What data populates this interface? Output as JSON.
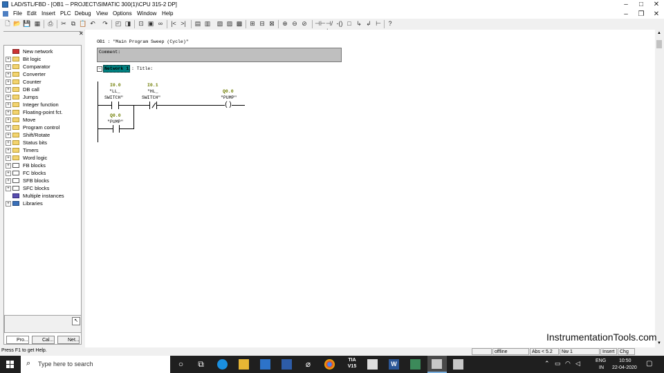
{
  "window": {
    "title": "LAD/STL/FBD  - [OB1 -- PROJECT\\SIMATIC 300(1)\\CPU 315-2 DP]"
  },
  "menu": [
    "File",
    "Edit",
    "Insert",
    "PLC",
    "Debug",
    "View",
    "Options",
    "Window",
    "Help"
  ],
  "tree": {
    "items": [
      {
        "label": "New network",
        "expand": ""
      },
      {
        "label": "Bit logic",
        "expand": "+"
      },
      {
        "label": "Comparator",
        "expand": "+"
      },
      {
        "label": "Converter",
        "expand": "+"
      },
      {
        "label": "Counter",
        "expand": "+"
      },
      {
        "label": "DB call",
        "expand": "+"
      },
      {
        "label": "Jumps",
        "expand": "+"
      },
      {
        "label": "Integer function",
        "expand": "+"
      },
      {
        "label": "Floating-point fct.",
        "expand": "+"
      },
      {
        "label": "Move",
        "expand": "+"
      },
      {
        "label": "Program control",
        "expand": "+"
      },
      {
        "label": "Shift/Rotate",
        "expand": "+"
      },
      {
        "label": "Status bits",
        "expand": "+"
      },
      {
        "label": "Timers",
        "expand": "+"
      },
      {
        "label": "Word logic",
        "expand": "+"
      },
      {
        "label": "FB blocks",
        "expand": "+"
      },
      {
        "label": "FC blocks",
        "expand": "+"
      },
      {
        "label": "SFB blocks",
        "expand": "+"
      },
      {
        "label": "SFC blocks",
        "expand": "+"
      },
      {
        "label": "Multiple instances",
        "expand": ""
      },
      {
        "label": "Libraries",
        "expand": "+"
      }
    ]
  },
  "tabs": [
    "Pro...",
    "Cal...",
    "Net..."
  ],
  "editor": {
    "block_title": "OB1 :   \"Main Program Sweep (Cycle)\"",
    "comment_label": "Comment:",
    "network_label": "Network 1",
    "network_title": ": Title:",
    "contacts": [
      {
        "addr": "I0.0",
        "sym1": "\"LL_",
        "sym2": "SWITCH\""
      },
      {
        "addr": "I0.1",
        "sym1": "\"HL_",
        "sym2": "SWITCH\""
      },
      {
        "addr": "Q0.0",
        "sym1": "\"PUMP\"",
        "sym2": ""
      }
    ],
    "coil": {
      "addr": "Q0.0",
      "sym": "\"PUMP\""
    }
  },
  "status": {
    "help": "Press F1 to get Help.",
    "mode": "offline",
    "abs": "Abs < 5.2",
    "nw": "Nw 1",
    "insert": "Insert",
    "chg": "Chg"
  },
  "watermark": "InstrumentationTools.com",
  "taskbar": {
    "search_placeholder": "Type here to search",
    "lang1": "ENG",
    "lang2": "IN",
    "time": "10:50",
    "date": "22-04-2020",
    "tia_label1": "TIA",
    "tia_label2": "V15"
  }
}
